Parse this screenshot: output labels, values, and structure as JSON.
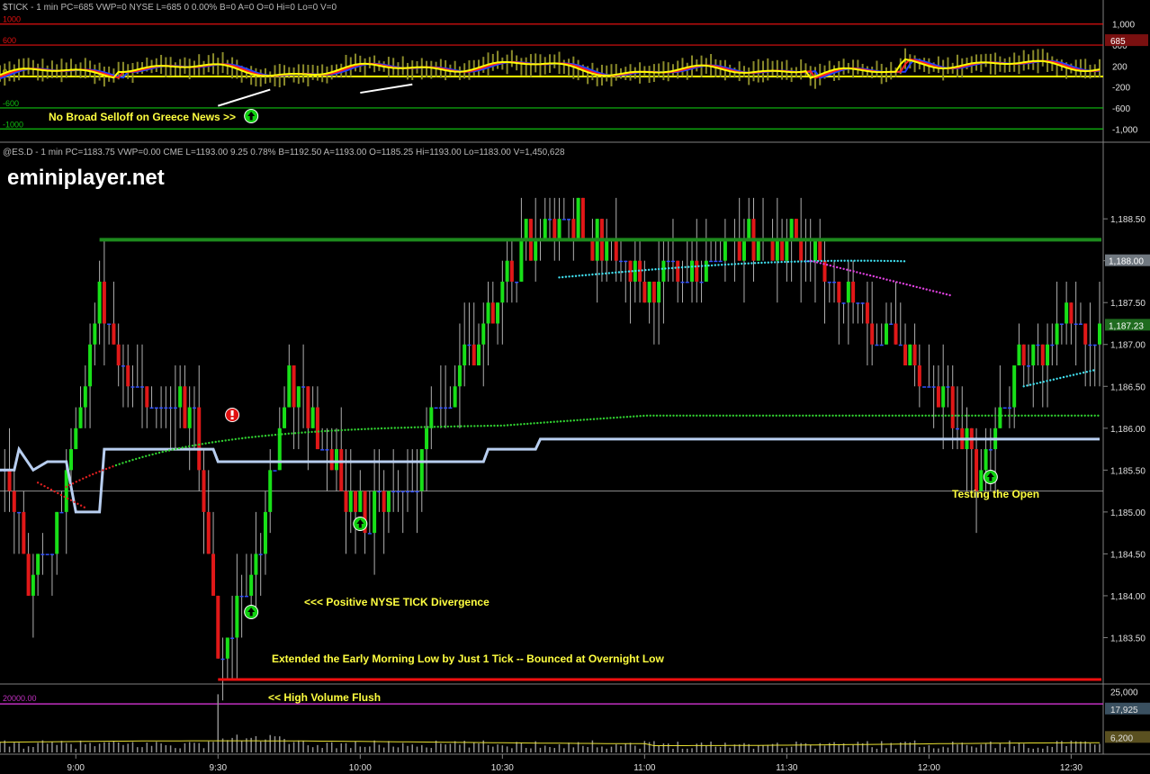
{
  "watermark": "eminiplayer.net",
  "chart_data": [
    {
      "panel": "tick",
      "type": "line",
      "header": "$TICK - 1 min  PC=685  VWP=0  NYSE  L=685  0  0.00%  B=0  A=0  O=0  Hi=0  Lo=0  V=0",
      "ylim": [
        -1150,
        1150
      ],
      "yticks": [
        "1,000",
        "600",
        "200",
        "-200",
        "-600",
        "-1,000"
      ],
      "ytick_values": [
        1000,
        600,
        200,
        -200,
        -600,
        -1000
      ],
      "last_value_label": "685",
      "levels": [
        {
          "label": "1000",
          "value": 1000,
          "color": "#e01010"
        },
        {
          "label": "600",
          "value": 600,
          "color": "#e01010"
        },
        {
          "label": "0",
          "value": 0,
          "color": "#ffff00"
        },
        {
          "label": "-600",
          "value": -600,
          "color": "#10c010"
        },
        {
          "label": "-1000",
          "value": -1000,
          "color": "#10c010"
        }
      ],
      "series_colors": {
        "bars": "#8a8a2a",
        "fast": "#ffff00",
        "mid": "#ff2020",
        "slow": "#2040ff"
      },
      "annotation": "No Broad Selloff on Greece News  >>"
    },
    {
      "panel": "price",
      "type": "bar",
      "header": "@ES.D - 1 min  PC=1183.75  VWP=0.00  CME  L=1193.00  9.25  0.78%  B=1192.50  A=1193.00  O=1185.25  Hi=1193.00  Lo=1183.00  V=1,450,628",
      "ylim": [
        1183.0,
        1189.2
      ],
      "yticks": [
        "1,188.50",
        "1,188.00",
        "1,187.50",
        "1,187.00",
        "1,186.50",
        "1,186.00",
        "1,185.50",
        "1,185.00",
        "1,184.50",
        "1,184.00",
        "1,183.50"
      ],
      "ytick_values": [
        1188.5,
        1188.0,
        1187.5,
        1187.0,
        1186.5,
        1186.0,
        1185.5,
        1185.0,
        1184.5,
        1184.0,
        1183.5
      ],
      "price_labels": [
        {
          "text": "1,188.00",
          "value": 1188.0,
          "color": "#707880"
        },
        {
          "text": "1,187.23",
          "value": 1187.23,
          "color": "#1f6b1f"
        }
      ],
      "x_ticks": [
        "9:00",
        "9:30",
        "10:00",
        "10:30",
        "11:00",
        "11:30",
        "12:00",
        "12:30"
      ],
      "resistance": 1188.25,
      "overnight_low": 1183.0,
      "open_line": 1185.25,
      "annotations": [
        "<<< Positive NYSE TICK Divergence",
        "Extended the Early Morning Low by Just 1 Tick -- Bounced at Overnight Low",
        "Testing the Open"
      ],
      "key_points": [
        {
          "time": "8:45",
          "price": 1185.5
        },
        {
          "time": "8:50",
          "price": 1184.2
        },
        {
          "time": "8:55",
          "price": 1184.5
        },
        {
          "time": "9:05",
          "price": 1187.5
        },
        {
          "time": "9:15",
          "price": 1186.3
        },
        {
          "time": "9:25",
          "price": 1186.2
        },
        {
          "time": "9:30",
          "price": 1183.25
        },
        {
          "time": "9:36",
          "price": 1183.9
        },
        {
          "time": "9:45",
          "price": 1186.5
        },
        {
          "time": "10:00",
          "price": 1185.0
        },
        {
          "time": "10:10",
          "price": 1185.3
        },
        {
          "time": "10:20",
          "price": 1186.6
        },
        {
          "time": "10:35",
          "price": 1188.3
        },
        {
          "time": "10:45",
          "price": 1188.5
        },
        {
          "time": "11:00",
          "price": 1187.8
        },
        {
          "time": "11:30",
          "price": 1188.3
        },
        {
          "time": "11:50",
          "price": 1187.2
        },
        {
          "time": "12:05",
          "price": 1186.2
        },
        {
          "time": "12:10",
          "price": 1185.4
        },
        {
          "time": "12:20",
          "price": 1186.8
        },
        {
          "time": "12:30",
          "price": 1187.2
        }
      ]
    },
    {
      "panel": "volume",
      "type": "bar",
      "ylim": [
        0,
        27500
      ],
      "yticks": [
        "25,000"
      ],
      "ytick_values": [
        25000
      ],
      "level": {
        "label": "20000.00",
        "value": 20000
      },
      "value_labels": [
        {
          "text": "17,925",
          "value": 17925
        },
        {
          "text": "6,200",
          "value": 6200
        }
      ],
      "annotation": "<< High Volume Flush"
    }
  ]
}
